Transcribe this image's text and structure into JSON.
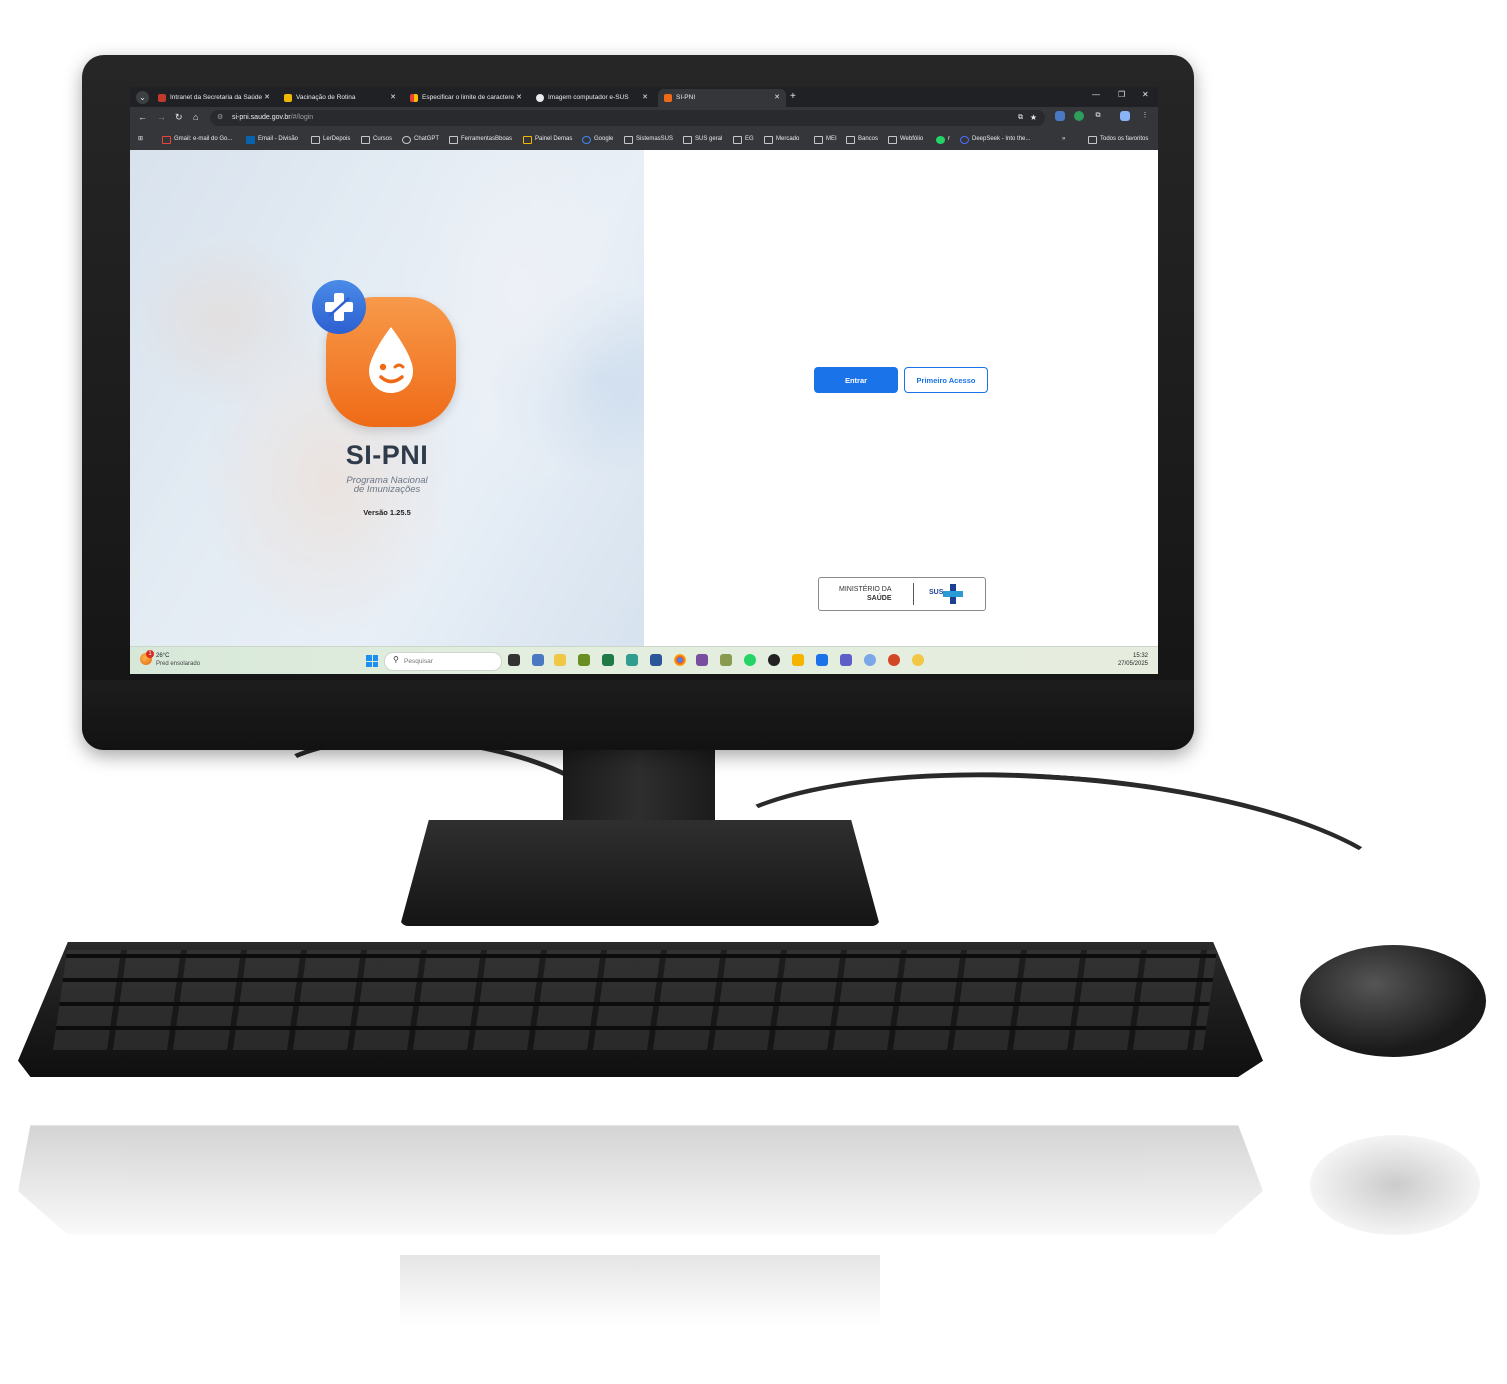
{
  "browser": {
    "tabs": [
      {
        "label": "Intranet da Secretaria da Saúde",
        "icon": "intranet-icon",
        "active": false
      },
      {
        "label": "Vacinação de Rotina",
        "icon": "vaccine-icon",
        "active": false
      },
      {
        "label": "Especificar o limite de caractere",
        "icon": "sheet-icon",
        "active": false
      },
      {
        "label": "Imagem computador e-SUS",
        "icon": "chatgpt-icon",
        "active": false
      },
      {
        "label": "SI-PNI",
        "icon": "sipni-icon",
        "active": true
      }
    ],
    "url_host": "si-pni.saude.gov.br",
    "url_path": "/#/login",
    "bookmarks": [
      "Gmail: e-mail do Go...",
      "Email - Divisão",
      "LerDepois",
      "Cursos",
      "ChatGPT",
      "FerramentasBboas",
      "Painel Demas",
      "Google",
      "SistemasSUS",
      "SUS geral",
      "EG",
      "Mercado",
      "MEI",
      "Bancos",
      "Webfólio",
      "r",
      "DeepSeek - Into the...",
      "Todos os favoritos"
    ],
    "bookmarks_overflow": "»"
  },
  "login": {
    "app_name": "SI-PNI",
    "subtitle_line1": "Programa Nacional",
    "subtitle_line2": "de Imunizações",
    "version": "Versão 1.25.5",
    "enter_button": "Entrar",
    "first_access_button": "Primeiro Acesso",
    "ministry_line1": "MINISTÉRIO DA",
    "ministry_line2": "SAÚDE",
    "sus_label": "SUS"
  },
  "taskbar": {
    "weather_temp": "26°C",
    "weather_desc": "Pred ensolarado",
    "weather_badge": "1",
    "search_placeholder": "Pesquisar",
    "time": "15:32",
    "date": "27/05/2025"
  },
  "colors": {
    "primary": "#1a73e8",
    "logo_orange": "#ef6a17",
    "badge_blue": "#2d5fd0",
    "sus_blue": "#1c3f94"
  }
}
